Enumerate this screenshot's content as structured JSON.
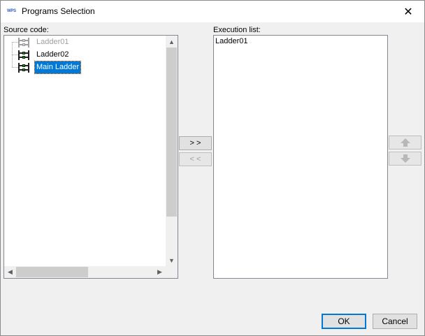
{
  "window": {
    "app_icon_label": "WPS",
    "title": "Programs Selection",
    "close_glyph": "✕"
  },
  "source": {
    "label": "Source code:",
    "items": [
      {
        "label": "Ladder01",
        "state": "disabled"
      },
      {
        "label": "Ladder02",
        "state": "normal"
      },
      {
        "label": "Main Ladder",
        "state": "selected"
      }
    ]
  },
  "execution": {
    "label": "Execution list:",
    "items": [
      "Ladder01"
    ]
  },
  "transfer": {
    "add_label": "> >",
    "remove_label": "< <"
  },
  "footer": {
    "ok_label": "OK",
    "cancel_label": "Cancel"
  },
  "icons": {
    "up": "arrow-up-icon",
    "down": "arrow-down-icon",
    "ladder": "ladder-icon"
  },
  "colors": {
    "selection": "#0078d7",
    "ladder_green": "#00a000",
    "ladder_dark": "#202020"
  }
}
